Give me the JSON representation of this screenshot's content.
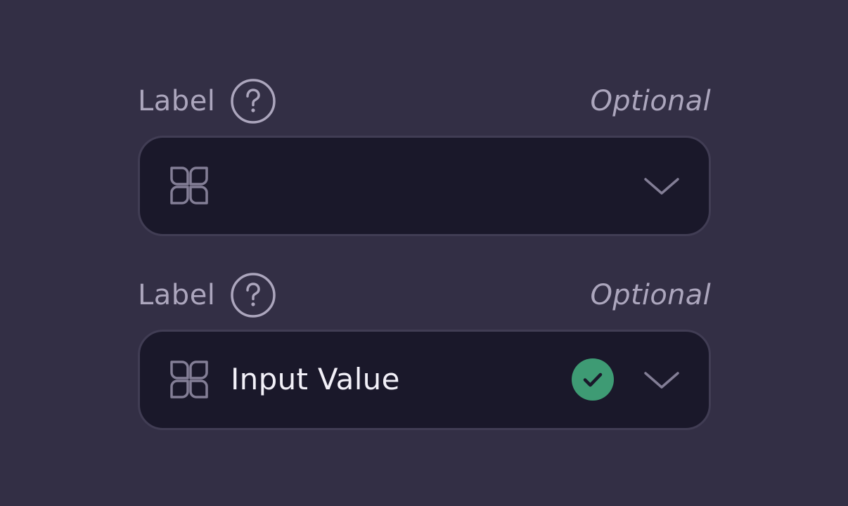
{
  "fields": [
    {
      "label": "Label",
      "optional": "Optional",
      "value": "",
      "leading_icon": "grid-icon",
      "help_icon": "question-circle-icon",
      "trailing_icon": "chevron-down-icon",
      "status": "empty"
    },
    {
      "label": "Label",
      "optional": "Optional",
      "value": "Input Value",
      "leading_icon": "grid-icon",
      "help_icon": "question-circle-icon",
      "trailing_icon": "chevron-down-icon",
      "status": "valid",
      "status_icon": "check-circle-icon"
    }
  ],
  "colors": {
    "background": "#332f45",
    "field_background": "#1a182a",
    "field_border": "#413d54",
    "label": "#aca6bd",
    "value": "#f2f0f8",
    "icon": "#837e96",
    "success": "#3e9b74"
  }
}
